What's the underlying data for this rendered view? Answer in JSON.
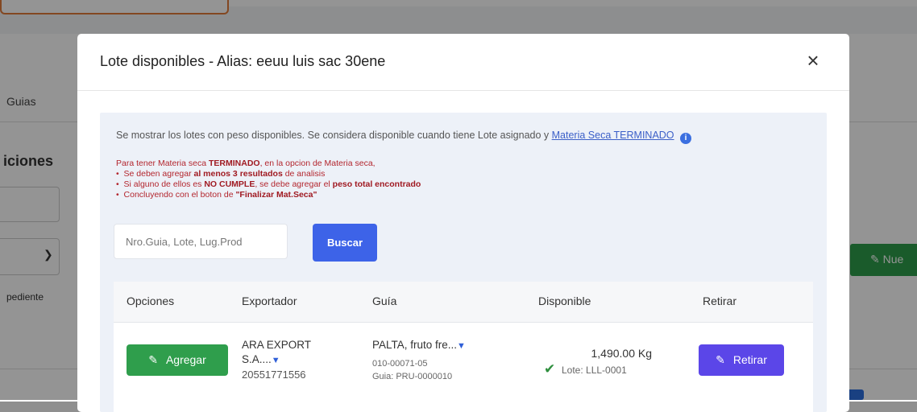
{
  "background": {
    "tab_label": "Guias",
    "section_title": "iciones",
    "field_label": "pediente",
    "green_button_label": "Nue"
  },
  "modal": {
    "title": "Lote disponibles - Alias: eeuu luis sac 30ene",
    "close_symbol": "×",
    "info_text": "Se mostrar los lotes con peso disponibles. Se considera disponible cuando tiene Lote asignado y",
    "info_link": "Materia Seca TERMINADO",
    "info_icon": "i",
    "warning": {
      "intro_prefix": "Para tener Materia seca ",
      "intro_bold": "TERMINADO",
      "intro_suffix": ", en la opcion de Materia seca,",
      "item1_prefix": "Se deben agregar ",
      "item1_bold": "al menos 3 resultados",
      "item1_suffix": " de analisis",
      "item2_prefix": "Si alguno de ellos es ",
      "item2_bold": "NO CUMPLE",
      "item2_mid": ", se debe agregar el ",
      "item2_bold2": "peso total encontrado",
      "item3_prefix": "Concluyendo con el boton de ",
      "item3_bold": "\"Finalizar Mat.Seca\""
    },
    "search": {
      "placeholder": "Nro.Guia, Lote, Lug.Prod",
      "button_label": "Buscar"
    },
    "table": {
      "headers": [
        "Opciones",
        "Exportador",
        "Guía",
        "Disponible",
        "Retirar"
      ],
      "rows": [
        {
          "agregar_label": "Agregar",
          "exportador_line1": "ARA EXPORT",
          "exportador_line2": "S.A....",
          "exportador_ruc": "20551771556",
          "guia_producto": "PALTA, fruto fre...",
          "guia_numero": "010-00071-05",
          "guia_codigo": "Guia: PRU-0000010",
          "disponible_peso": "1,490.00 Kg",
          "disponible_lote": "Lote: LLL-0001",
          "retirar_label": "Retirar"
        }
      ]
    }
  },
  "colors": {
    "agregar_green": "#2f9e4c",
    "retirar_purple": "#5b46e8",
    "buscar_blue": "#3d63e8",
    "warning_red": "#b3262e",
    "link_blue": "#3b5fc8"
  }
}
